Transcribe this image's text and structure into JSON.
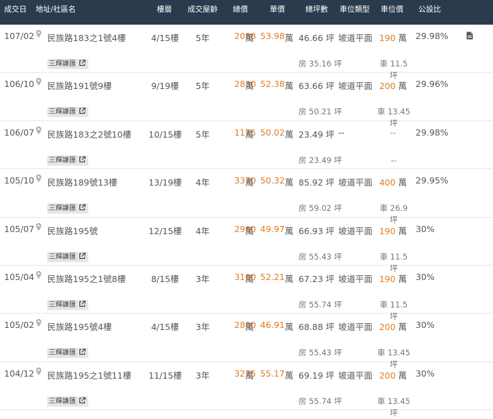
{
  "header": {
    "date": "成交日",
    "address": "地址/社區名",
    "floor": "樓層",
    "age": "成交屋齡",
    "total_price": "總價",
    "unit_price": "單價",
    "area": "總坪數",
    "parking_type": "車位類型",
    "parking_price": "車位價",
    "ratio": "公設比"
  },
  "tag_label": "三輝謙匯",
  "rows": [
    {
      "date": "107/02",
      "address": "民族路183之1號4樓",
      "floor": "4/15樓",
      "age": "5年",
      "total": "2088",
      "total_unit": "萬",
      "unit_price": "53.98",
      "unit_unit": "萬",
      "area": "46.66 坪",
      "parking_type": "坡道平面",
      "parking_price": "190",
      "parking_unit": "萬",
      "ratio": "29.98%",
      "house_area": "房 35.16 坪",
      "car_area": "車 11.5 坪"
    },
    {
      "date": "106/10",
      "address": "民族路191號9樓",
      "floor": "9/19樓",
      "age": "5年",
      "total": "2830",
      "total_unit": "萬",
      "unit_price": "52.38",
      "unit_unit": "萬",
      "area": "63.66 坪",
      "parking_type": "坡道平面",
      "parking_price": "200",
      "parking_unit": "萬",
      "ratio": "29.96%",
      "house_area": "房 50.21 坪",
      "car_area": "車 13.45 坪"
    },
    {
      "date": "106/07",
      "address": "民族路183之2號10樓",
      "floor": "10/15樓",
      "age": "5年",
      "total": "1175",
      "total_unit": "萬",
      "unit_price": "50.02",
      "unit_unit": "萬",
      "area": "23.49 坪",
      "parking_type": "--",
      "parking_price": "--",
      "parking_unit": "",
      "ratio": "29.98%",
      "house_area": "房 23.49 坪",
      "car_area": "--"
    },
    {
      "date": "105/10",
      "address": "民族路189號13樓",
      "floor": "13/19樓",
      "age": "4年",
      "total": "3370",
      "total_unit": "萬",
      "unit_price": "50.32",
      "unit_unit": "萬",
      "area": "85.92 坪",
      "parking_type": "坡道平面",
      "parking_price": "400",
      "parking_unit": "萬",
      "ratio": "29.95%",
      "house_area": "房 59.02 坪",
      "car_area": "車 26.9 坪"
    },
    {
      "date": "105/07",
      "address": "民族路195號",
      "floor": "12/15樓",
      "age": "4年",
      "total": "2960",
      "total_unit": "萬",
      "unit_price": "49.97",
      "unit_unit": "萬",
      "area": "66.93 坪",
      "parking_type": "坡道平面",
      "parking_price": "190",
      "parking_unit": "萬",
      "ratio": "30%",
      "house_area": "房 55.43 坪",
      "car_area": "車 11.5 坪"
    },
    {
      "date": "105/04",
      "address": "民族路195之1號8樓",
      "floor": "8/15樓",
      "age": "3年",
      "total": "3100",
      "total_unit": "萬",
      "unit_price": "52.21",
      "unit_unit": "萬",
      "area": "67.23 坪",
      "parking_type": "坡道平面",
      "parking_price": "190",
      "parking_unit": "萬",
      "ratio": "30%",
      "house_area": "房 55.74 坪",
      "car_area": "車 11.5 坪"
    },
    {
      "date": "105/02",
      "address": "民族路195號4樓",
      "floor": "4/15樓",
      "age": "3年",
      "total": "2800",
      "total_unit": "萬",
      "unit_price": "46.91",
      "unit_unit": "萬",
      "area": "68.88 坪",
      "parking_type": "坡道平面",
      "parking_price": "200",
      "parking_unit": "萬",
      "ratio": "30%",
      "house_area": "房 55.43 坪",
      "car_area": "車 13.45 坪"
    },
    {
      "date": "104/12",
      "address": "民族路195之1號11樓",
      "floor": "11/15樓",
      "age": "3年",
      "total": "3275",
      "total_unit": "萬",
      "unit_price": "55.17",
      "unit_unit": "萬",
      "area": "69.19 坪",
      "parking_type": "坡道平面",
      "parking_price": "200",
      "parking_unit": "萬",
      "ratio": "30%",
      "house_area": "房 55.74 坪",
      "car_area": "車 13.45 坪"
    }
  ],
  "icons": {
    "pin": "map-pin-icon",
    "external": "external-link-icon",
    "doc": "document-icon"
  },
  "colors": {
    "header_bg": "#2b3b4e",
    "price": "#e07b22",
    "tag_bg": "#e4e7ea"
  }
}
